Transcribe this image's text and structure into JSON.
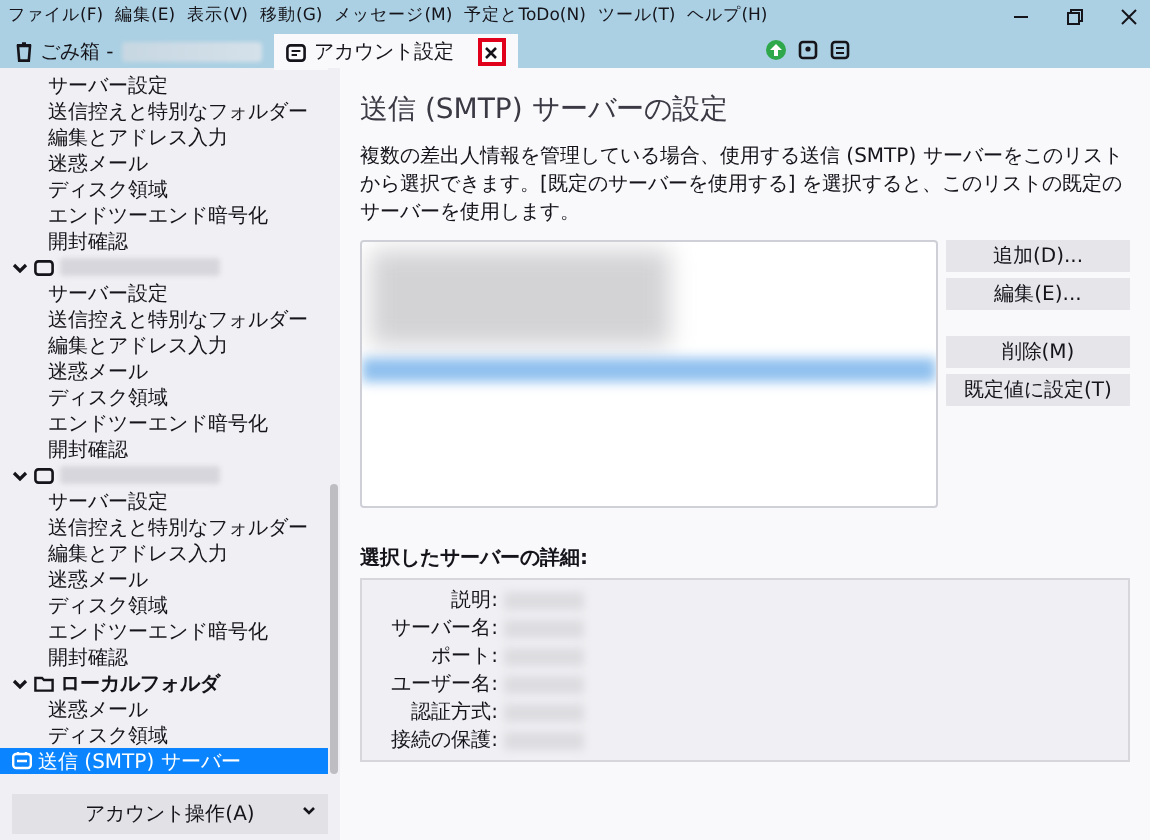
{
  "menu": [
    "ファイル(F)",
    "編集(E)",
    "表示(V)",
    "移動(G)",
    "メッセージ(M)",
    "予定とToDo(N)",
    "ツール(T)",
    "ヘルプ(H)"
  ],
  "tabs": [
    {
      "kind": "trash",
      "label": "ごみ箱 -",
      "selected": false
    },
    {
      "kind": "settings",
      "label": "アカウント設定",
      "selected": true,
      "close_highlighted": true
    }
  ],
  "sidebar": {
    "items": [
      {
        "kind": "setting",
        "label": "サーバー設定",
        "selected": false
      },
      {
        "kind": "setting",
        "label": "送信控えと特別なフォルダー",
        "selected": false
      },
      {
        "kind": "setting",
        "label": "編集とアドレス入力",
        "selected": false
      },
      {
        "kind": "setting",
        "label": "迷惑メール",
        "selected": false
      },
      {
        "kind": "setting",
        "label": "ディスク領域",
        "selected": false
      },
      {
        "kind": "setting",
        "label": "エンドツーエンド暗号化",
        "selected": false
      },
      {
        "kind": "setting",
        "label": "開封確認",
        "selected": false
      },
      {
        "kind": "account",
        "expanded": true,
        "children": [
          {
            "kind": "setting",
            "label": "サーバー設定",
            "selected": false
          },
          {
            "kind": "setting",
            "label": "送信控えと特別なフォルダー",
            "selected": false
          },
          {
            "kind": "setting",
            "label": "編集とアドレス入力",
            "selected": false
          },
          {
            "kind": "setting",
            "label": "迷惑メール",
            "selected": false
          },
          {
            "kind": "setting",
            "label": "ディスク領域",
            "selected": false
          },
          {
            "kind": "setting",
            "label": "エンドツーエンド暗号化",
            "selected": false
          },
          {
            "kind": "setting",
            "label": "開封確認",
            "selected": false
          }
        ]
      },
      {
        "kind": "account",
        "expanded": true,
        "children": [
          {
            "kind": "setting",
            "label": "サーバー設定",
            "selected": false
          },
          {
            "kind": "setting",
            "label": "送信控えと特別なフォルダー",
            "selected": false
          },
          {
            "kind": "setting",
            "label": "編集とアドレス入力",
            "selected": false
          },
          {
            "kind": "setting",
            "label": "迷惑メール",
            "selected": false
          },
          {
            "kind": "setting",
            "label": "ディスク領域",
            "selected": false
          },
          {
            "kind": "setting",
            "label": "エンドツーエンド暗号化",
            "selected": false
          },
          {
            "kind": "setting",
            "label": "開封確認",
            "selected": false
          }
        ]
      },
      {
        "kind": "folder",
        "label": "ローカルフォルダ",
        "expanded": true,
        "children": [
          {
            "kind": "setting",
            "label": "迷惑メール",
            "selected": false
          },
          {
            "kind": "setting",
            "label": "ディスク領域",
            "selected": false
          }
        ]
      },
      {
        "kind": "server",
        "label": "送信 (SMTP) サーバー",
        "selected": true
      }
    ],
    "account_actions": "アカウント操作(A)"
  },
  "main": {
    "title": "送信 (SMTP) サーバーの設定",
    "description": "複数の差出人情報を管理している場合、使用する送信 (SMTP) サーバーをこのリストから選択できます。[既定のサーバーを使用する] を選択すると、このリストの既定のサーバーを使用します。",
    "button_groups": [
      [
        "追加(D)...",
        "編集(E)..."
      ],
      [
        "削除(M)",
        "既定値に設定(T)"
      ]
    ],
    "details": {
      "heading": "選択したサーバーの詳細:",
      "fields": [
        "説明:",
        "サーバー名:",
        "ポート:",
        "ユーザー名:",
        "認証方式:",
        "接続の保護:"
      ]
    }
  }
}
